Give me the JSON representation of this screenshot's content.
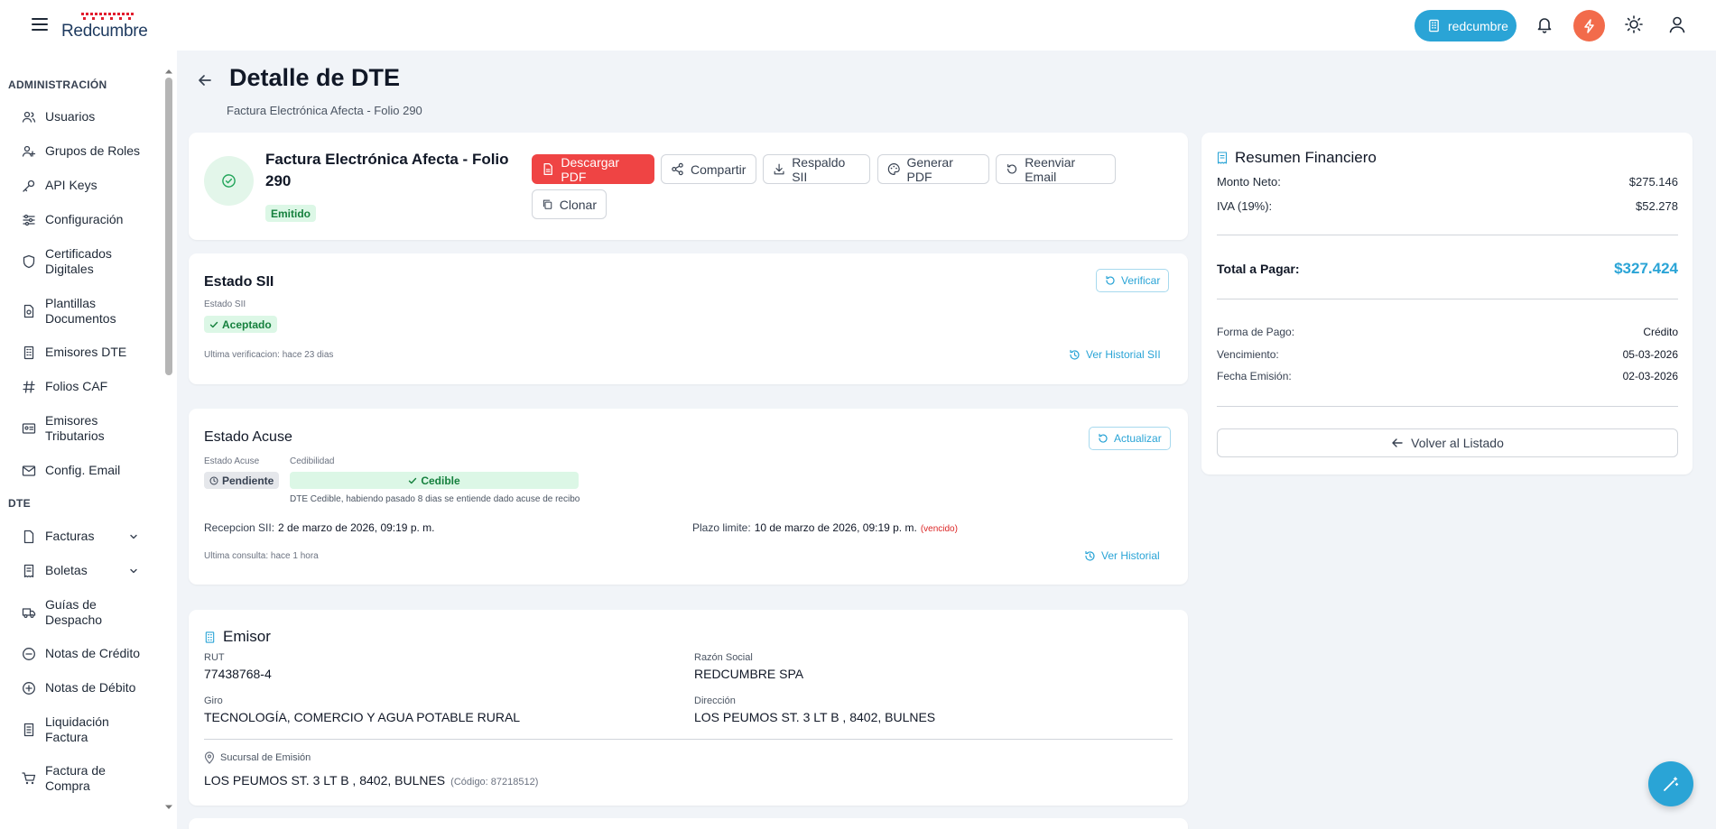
{
  "app": {
    "logo_text": "Redcumbre",
    "org_label": "redcumbre",
    "colors": {
      "accent": "#2aa4d6",
      "danger": "#ef4444",
      "success_bg": "#dcf7e6",
      "success_fg": "#15803d",
      "alert": "#f26b4b"
    }
  },
  "topbar": {
    "icons": [
      "menu-icon",
      "building-icon",
      "bell-icon",
      "bolt-icon",
      "sun-icon",
      "user-icon"
    ]
  },
  "sidebar": {
    "sections": [
      {
        "label": "ADMINISTRACIÓN",
        "items": [
          {
            "label": "Usuarios",
            "icon": "users-icon"
          },
          {
            "label": "Grupos de Roles",
            "icon": "user-group-icon"
          },
          {
            "label": "API Keys",
            "icon": "key-icon"
          },
          {
            "label": "Configuración",
            "icon": "sliders-icon"
          },
          {
            "label": "Certificados Digitales",
            "icon": "shield-icon"
          },
          {
            "label": "Plantillas Documentos",
            "icon": "file-template-icon"
          },
          {
            "label": "Emisores DTE",
            "icon": "building-icon"
          },
          {
            "label": "Folios CAF",
            "icon": "hash-icon"
          },
          {
            "label": "Emisores Tributarios",
            "icon": "id-card-icon"
          },
          {
            "label": "Config. Email",
            "icon": "mail-icon"
          }
        ]
      },
      {
        "label": "DTE",
        "items": [
          {
            "label": "Facturas",
            "icon": "file-icon",
            "expandable": true
          },
          {
            "label": "Boletas",
            "icon": "receipt-icon",
            "expandable": true
          },
          {
            "label": "Guías de Despacho",
            "icon": "truck-icon"
          },
          {
            "label": "Notas de Crédito",
            "icon": "minus-circle-icon"
          },
          {
            "label": "Notas de Débito",
            "icon": "plus-circle-icon"
          },
          {
            "label": "Liquidación Factura",
            "icon": "receipt-icon"
          },
          {
            "label": "Factura de Compra",
            "icon": "cart-icon"
          }
        ]
      }
    ]
  },
  "page": {
    "title": "Detalle de DTE",
    "subtitle": "Factura Electrónica Afecta - Folio 290"
  },
  "header_card": {
    "doc_title": "Factura Electrónica Afecta - Folio 290",
    "status": "Emitido",
    "actions": {
      "download_pdf": "Descargar PDF",
      "share": "Compartir",
      "backup_sii": "Respaldo SII",
      "generate_pdf": "Generar PDF",
      "resend_email": "Reenviar Email",
      "clone": "Clonar"
    }
  },
  "estado_sii": {
    "title": "Estado SII",
    "label": "Estado SII",
    "value": "Aceptado",
    "verify_button": "Verificar",
    "last_check": "Ultima verificacion: hace 23 dias",
    "history_link": "Ver Historial SII"
  },
  "estado_acuse": {
    "title": "Estado Acuse",
    "acuse_label": "Estado Acuse",
    "acuse_value": "Pendiente",
    "cedibilidad_label": "Cedibilidad",
    "cedibilidad_value": "Cedible",
    "cedibilidad_note": "DTE Cedible, habiendo pasado 8 dias se entiende dado acuse de recibo",
    "update_button": "Actualizar",
    "reception_label": "Recepcion SII:",
    "reception_value": "2 de marzo de 2026, 09:19 p. m.",
    "deadline_label": "Plazo limite:",
    "deadline_value": "10 de marzo de 2026, 09:19 p. m.",
    "deadline_status": "(vencido)",
    "last_query": "Ultima consulta: hace 1 hora",
    "history_link": "Ver Historial"
  },
  "emisor": {
    "title": "Emisor",
    "rut_label": "RUT",
    "rut": "77438768-4",
    "razon_label": "Razón Social",
    "razon": "REDCUMBRE SPA",
    "giro_label": "Giro",
    "giro": "TECNOLOGÍA, COMERCIO Y AGUA POTABLE RURAL",
    "direccion_label": "Dirección",
    "direccion": "LOS PEUMOS ST. 3 LT B , 8402, BULNES",
    "sucursal_label": "Sucursal de Emisión",
    "sucursal": "LOS PEUMOS ST. 3 LT B , 8402, BULNES",
    "sucursal_code": "(Código: 87218512)"
  },
  "resumen": {
    "title": "Resumen Financiero",
    "neto_label": "Monto Neto:",
    "neto": "$275.146",
    "iva_label": "IVA (19%):",
    "iva": "$52.278",
    "total_label": "Total a Pagar:",
    "total": "$327.424",
    "forma_label": "Forma de Pago:",
    "forma": "Crédito",
    "venc_label": "Vencimiento:",
    "venc": "05-03-2026",
    "fecha_label": "Fecha Emisión:",
    "fecha": "02-03-2026",
    "back_button": "Volver al Listado"
  }
}
